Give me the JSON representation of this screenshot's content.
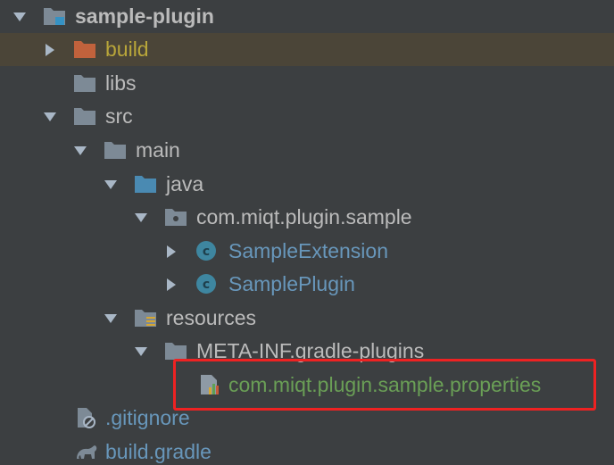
{
  "colors": {
    "background": "#3c3f41",
    "selection": "#4b4538",
    "folder": "#7d8a96",
    "excluded_folder": "#c1623c",
    "source_folder": "#4a8ab2",
    "class_icon": "#3e86a0",
    "highlight": "#ee2222"
  },
  "tree": {
    "root": {
      "label": "sample-plugin",
      "icon": "project-folder-icon",
      "expanded": true
    },
    "build": {
      "label": "build",
      "icon": "excluded-folder-icon",
      "expanded": false,
      "selected": true
    },
    "libs": {
      "label": "libs",
      "icon": "folder-icon"
    },
    "src": {
      "label": "src",
      "icon": "folder-icon",
      "expanded": true
    },
    "main": {
      "label": "main",
      "icon": "folder-icon",
      "expanded": true
    },
    "java": {
      "label": "java",
      "icon": "source-folder-icon",
      "expanded": true
    },
    "package": {
      "label": "com.miqt.plugin.sample",
      "icon": "package-icon",
      "expanded": true
    },
    "sample_extension": {
      "label": "SampleExtension",
      "icon": "class-icon",
      "icon_letter": "c",
      "expanded": false
    },
    "sample_plugin": {
      "label": "SamplePlugin",
      "icon": "class-icon",
      "icon_letter": "c",
      "expanded": false
    },
    "resources": {
      "label": "resources",
      "icon": "resources-folder-icon",
      "expanded": true
    },
    "meta_inf": {
      "label": "META-INF.gradle-plugins",
      "icon": "folder-icon",
      "expanded": true
    },
    "properties_file": {
      "label": "com.miqt.plugin.sample.properties",
      "icon": "properties-file-icon",
      "highlighted": true
    },
    "gitignore": {
      "label": ".gitignore",
      "icon": "ignored-file-icon"
    },
    "build_gradle": {
      "label": "build.gradle",
      "icon": "gradle-icon"
    }
  }
}
